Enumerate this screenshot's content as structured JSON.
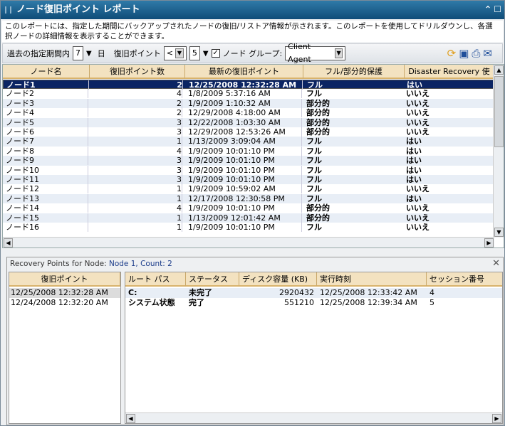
{
  "title": "ノード復旧ポイント レポート",
  "description": "このレポートには、指定した期間にバックアップされたノードの復旧/リストア情報が示されます。このレポートを使用してドリルダウンし、各選択ノードの詳細情報を表示することができます。",
  "toolbar": {
    "period_label": "過去の指定期間内",
    "period_value": "7",
    "days_label": "日",
    "rp_label": "復旧ポイント",
    "rp_op": "<",
    "rp_value": "5",
    "group_label": "ノード グループ:",
    "group_value": "Client Agent",
    "checked": true
  },
  "columns": [
    "ノード名",
    "復旧ポイント数",
    "最新の復旧ポイント",
    "フル/部分的保護",
    "Disaster Recovery 使用"
  ],
  "rows": [
    [
      "ノード1",
      "2",
      "12/25/2008 12:32:28 AM",
      "フル",
      "はい"
    ],
    [
      "ノード2",
      "4",
      "1/8/2009 5:37:16 AM",
      "フル",
      "いいえ"
    ],
    [
      "ノード3",
      "2",
      "1/9/2009 1:10:32 AM",
      "部分的",
      "いいえ"
    ],
    [
      "ノード4",
      "2",
      "12/29/2008 4:18:00 AM",
      "部分的",
      "いいえ"
    ],
    [
      "ノード5",
      "3",
      "12/22/2008 1:03:30 AM",
      "部分的",
      "いいえ"
    ],
    [
      "ノード6",
      "3",
      "12/29/2008 12:53:26 AM",
      "部分的",
      "いいえ"
    ],
    [
      "ノード7",
      "1",
      "1/13/2009 3:09:04 AM",
      "フル",
      "はい"
    ],
    [
      "ノード8",
      "4",
      "1/9/2009 10:01:10 PM",
      "フル",
      "はい"
    ],
    [
      "ノード9",
      "3",
      "1/9/2009 10:01:10 PM",
      "フル",
      "はい"
    ],
    [
      "ノード10",
      "3",
      "1/9/2009 10:01:10 PM",
      "フル",
      "はい"
    ],
    [
      "ノード11",
      "3",
      "1/9/2009 10:01:10 PM",
      "フル",
      "はい"
    ],
    [
      "ノード12",
      "1",
      "1/9/2009 10:59:02 AM",
      "フル",
      "いいえ"
    ],
    [
      "ノード13",
      "1",
      "12/17/2008 12:30:58 PM",
      "フル",
      "はい"
    ],
    [
      "ノード14",
      "4",
      "1/9/2009 10:01:10 PM",
      "部分的",
      "いいえ"
    ],
    [
      "ノード15",
      "1",
      "1/13/2009 12:01:42 AM",
      "部分的",
      "いいえ"
    ],
    [
      "ノード16",
      "1",
      "1/9/2009 10:01:10 PM",
      "フル",
      "いいえ"
    ]
  ],
  "detail": {
    "label": "Recovery Points for Node:",
    "node": "Node 1, Count: 2",
    "left_header": "復旧ポイント",
    "points": [
      "12/25/2008 12:32:28 AM",
      "12/24/2008 12:32:20 AM"
    ],
    "columns": [
      "ルート パス",
      "ステータス",
      "ディスク容量 (KB)",
      "実行時刻",
      "セッション番号"
    ],
    "rows": [
      [
        "C:",
        "未完了",
        "2920432",
        "12/25/2008 12:33:42 AM",
        "4"
      ],
      [
        "システム状態",
        "完了",
        "551210",
        "12/25/2008 12:39:34 AM",
        "5"
      ]
    ]
  }
}
